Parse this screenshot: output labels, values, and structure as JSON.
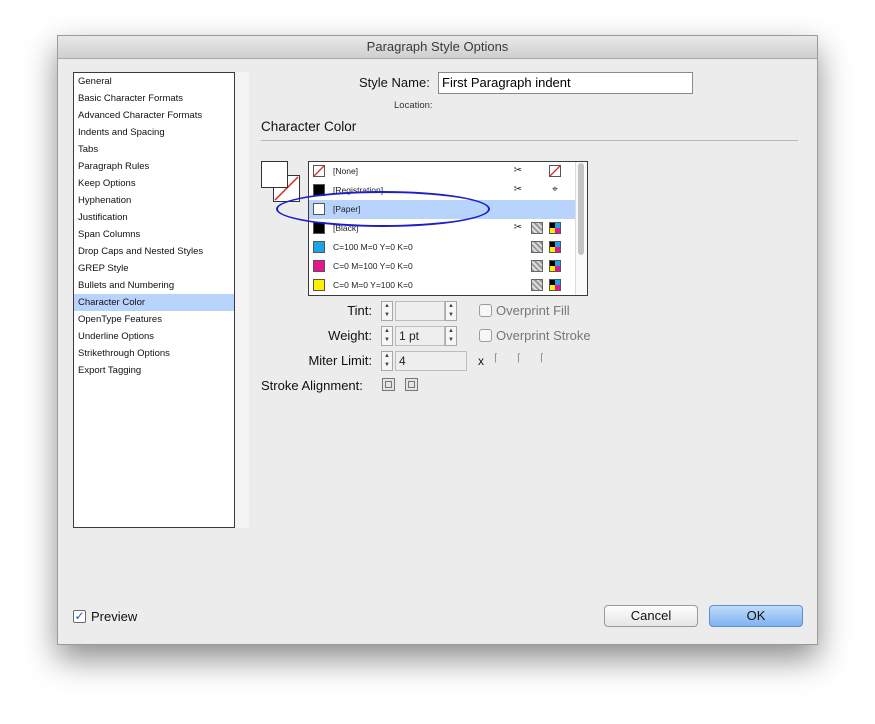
{
  "window": {
    "title": "Paragraph Style Options"
  },
  "sidebar": {
    "items": [
      {
        "label": "General"
      },
      {
        "label": "Basic Character Formats"
      },
      {
        "label": "Advanced Character Formats"
      },
      {
        "label": "Indents and Spacing"
      },
      {
        "label": "Tabs"
      },
      {
        "label": "Paragraph Rules"
      },
      {
        "label": "Keep Options"
      },
      {
        "label": "Hyphenation"
      },
      {
        "label": "Justification"
      },
      {
        "label": "Span Columns"
      },
      {
        "label": "Drop Caps and Nested Styles"
      },
      {
        "label": "GREP Style"
      },
      {
        "label": "Bullets and Numbering"
      },
      {
        "label": "Character Color",
        "selected": true
      },
      {
        "label": "OpenType Features"
      },
      {
        "label": "Underline Options"
      },
      {
        "label": "Strikethrough Options"
      },
      {
        "label": "Export Tagging"
      }
    ]
  },
  "header": {
    "style_name_label": "Style Name:",
    "style_name_value": "First Paragraph indent",
    "location_label": "Location:",
    "section_title": "Character Color"
  },
  "swatches": [
    {
      "name": "[None]",
      "color": "none",
      "icons": [
        "scissors-icon",
        "none-icon"
      ]
    },
    {
      "name": "[Registration]",
      "color": "#000000",
      "icons": [
        "scissors-icon",
        "registration-icon"
      ]
    },
    {
      "name": "[Paper]",
      "color": "#ffffff",
      "selected": true,
      "icons": []
    },
    {
      "name": "[Black]",
      "color": "#000000",
      "icons": [
        "scissors-icon",
        "spot-icon",
        "cmyk-icon"
      ]
    },
    {
      "name": "C=100 M=0 Y=0 K=0",
      "color": "#1aa5e6",
      "icons": [
        "spot-icon",
        "cmyk-icon"
      ]
    },
    {
      "name": "C=0 M=100 Y=0 K=0",
      "color": "#e6168c",
      "icons": [
        "spot-icon",
        "cmyk-icon"
      ]
    },
    {
      "name": "C=0 M=0 Y=100 K=0",
      "color": "#ffef00",
      "icons": [
        "spot-icon",
        "cmyk-icon"
      ]
    }
  ],
  "controls": {
    "tint_label": "Tint:",
    "tint_value": "",
    "overprint_fill_label": "Overprint Fill",
    "weight_label": "Weight:",
    "weight_value": "1 pt",
    "overprint_stroke_label": "Overprint Stroke",
    "miter_label": "Miter Limit:",
    "miter_value": "4",
    "miter_x": "x",
    "stroke_alignment_label": "Stroke Alignment:"
  },
  "footer": {
    "preview_label": "Preview",
    "preview_checked": true,
    "cancel_label": "Cancel",
    "ok_label": "OK"
  },
  "annotation": {
    "color": "#1d1ec9"
  },
  "accent": "#b8d4fc"
}
